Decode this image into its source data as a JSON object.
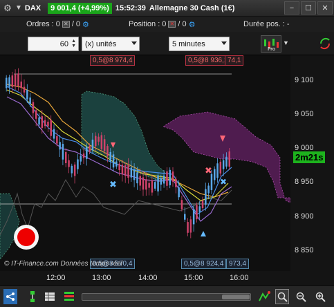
{
  "titlebar": {
    "symbol": "DAX",
    "price_change": "9 001,4 (+4,99%)",
    "time": "15:52:39",
    "instrument": "Allemagne 30 Cash (1€)",
    "window_buttons": [
      "−",
      "☐",
      "✕"
    ]
  },
  "orders_bar": {
    "orders_label": "Ordres :",
    "orders_count": "0",
    "orders_separator": "/",
    "orders_pending": "0",
    "position_label": "Position :",
    "position_count": "0",
    "position_separator": "/",
    "position_pending": "0",
    "duration_label": "Durée pos. :",
    "duration_value": "-"
  },
  "controls": {
    "units_value": "60",
    "units_type": "(x) unités",
    "timeframe": "5 minutes"
  },
  "chart": {
    "y_ticks": [
      "9 100",
      "9 050",
      "9 000",
      "8 950",
      "8 900",
      "8 850"
    ],
    "x_ticks": [
      "12:00",
      "13:00",
      "14:00",
      "15:00",
      "16:00"
    ],
    "order_tags_top": [
      "0,5@8 974,4",
      "0,5@8 936,1",
      "74,1"
    ],
    "order_tags_bottom": [
      "0,5@8 870,4",
      "0,5@8 924,4",
      "973,4"
    ],
    "timer": "2m21s",
    "copyright": "© IT-Finance.com Données temps réel",
    "colors": {
      "cloud_bull": "#1d4a47",
      "cloud_bear": "#5a1f5a",
      "candle_up": "#5aa7e8",
      "candle_down": "#d0436b",
      "price_green": "#1aa51a"
    }
  },
  "bottom_toolbar": {
    "icons": [
      "share-icon",
      "link-icon",
      "table-icon",
      "cut-icon",
      "indicator-icon",
      "zoom-fit-icon",
      "zoom-out-icon",
      "zoom-in-icon"
    ]
  }
}
